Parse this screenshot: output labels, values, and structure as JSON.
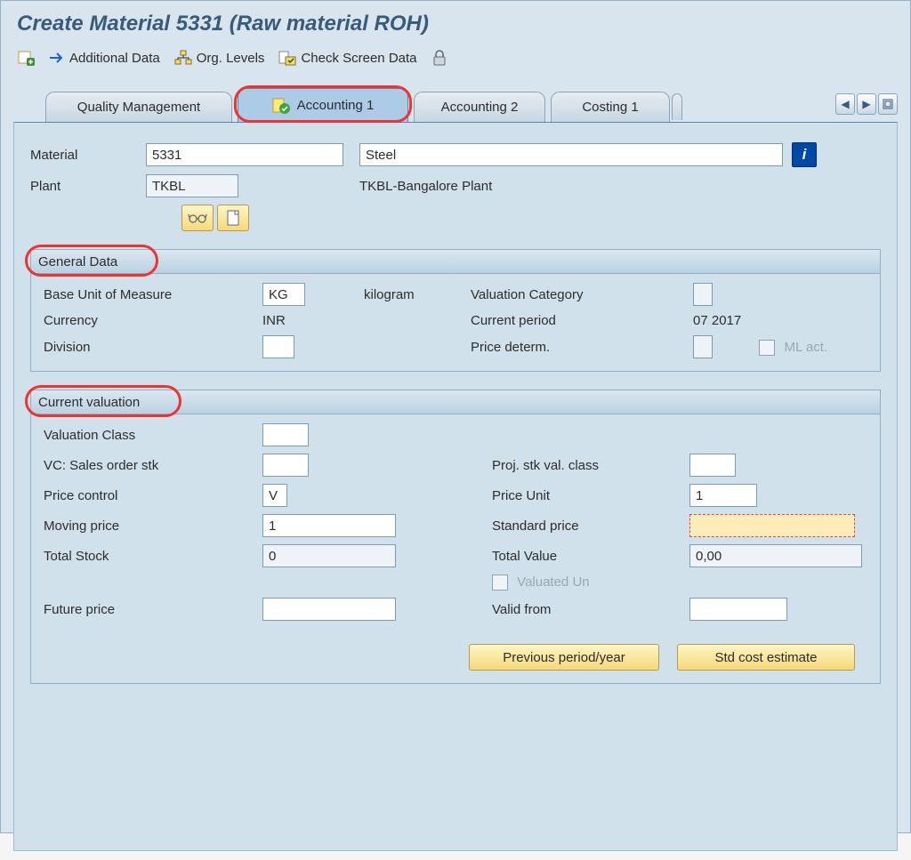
{
  "title": "Create Material 5331 (Raw material ROH)",
  "toolbar": {
    "additional_data": "Additional Data",
    "org_levels": "Org. Levels",
    "check_screen_data": "Check Screen Data"
  },
  "tabs": {
    "t0": "Quality Management",
    "t1": "Accounting 1",
    "t2": "Accounting 2",
    "t3": "Costing 1"
  },
  "header": {
    "material_label": "Material",
    "material_value": "5331",
    "material_desc": "Steel",
    "plant_label": "Plant",
    "plant_value": "TKBL",
    "plant_desc": "TKBL-Bangalore Plant"
  },
  "general": {
    "title": "General Data",
    "buom_label": "Base Unit of Measure",
    "buom_value": "KG",
    "buom_text": "kilogram",
    "valcat_label": "Valuation Category",
    "valcat_value": "",
    "currency_label": "Currency",
    "currency_value": "INR",
    "curperiod_label": "Current period",
    "curperiod_value": "07 2017",
    "division_label": "Division",
    "division_value": "",
    "pricedet_label": "Price determ.",
    "pricedet_value": "",
    "mlact_label": "ML act."
  },
  "valuation": {
    "title": "Current valuation",
    "valclass_label": "Valuation Class",
    "valclass_value": "",
    "vcsales_label": "VC: Sales order stk",
    "vcsales_value": "",
    "projstk_label": "Proj. stk val. class",
    "projstk_value": "",
    "pricecontrol_label": "Price control",
    "pricecontrol_value": "V",
    "priceunit_label": "Price Unit",
    "priceunit_value": "1",
    "movingprice_label": "Moving price",
    "movingprice_value": "1",
    "stdprice_label": "Standard price",
    "stdprice_value": "",
    "totalstock_label": "Total Stock",
    "totalstock_value": "0",
    "totalvalue_label": "Total Value",
    "totalvalue_value": "0,00",
    "valuatedun_label": "Valuated Un",
    "futureprice_label": "Future price",
    "futureprice_value": "",
    "validfrom_label": "Valid from",
    "validfrom_value": "",
    "prevperiod_btn": "Previous period/year",
    "stdcost_btn": "Std cost estimate"
  }
}
